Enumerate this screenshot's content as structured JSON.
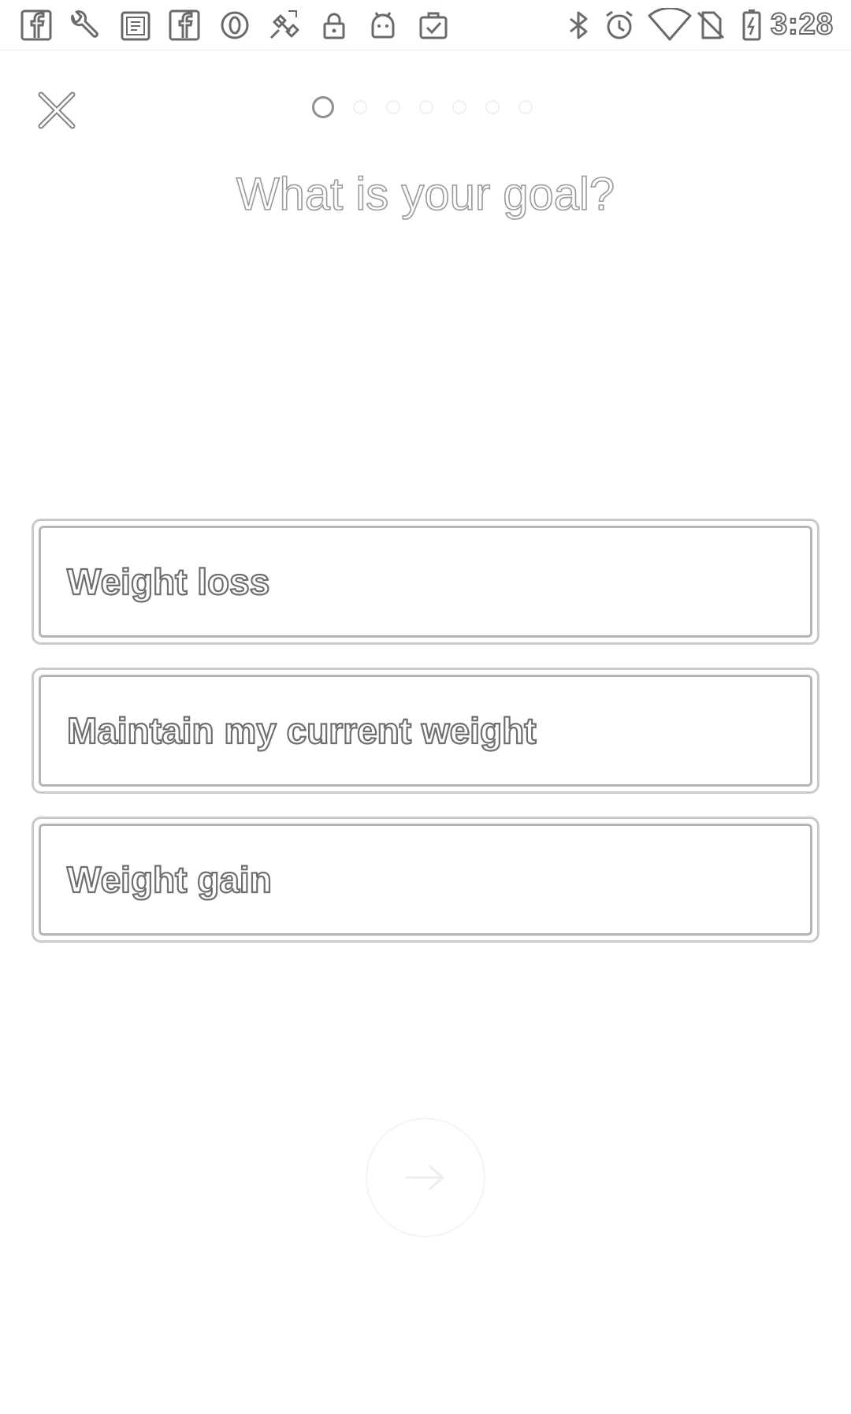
{
  "status_bar": {
    "time": "3:28",
    "left_icons": [
      "facebook-icon",
      "wrench-icon",
      "calendar-app-icon",
      "facebook-icon",
      "opera-icon",
      "satellite-icon",
      "lock-icon",
      "android-icon",
      "clipboard-check-icon"
    ],
    "right_icons": [
      "bluetooth-icon",
      "alarm-icon",
      "wifi-icon",
      "no-sim-icon",
      "battery-charging-icon"
    ]
  },
  "header": {
    "close_icon": "close-icon",
    "progress": {
      "current_step": 1,
      "total_steps": 7
    }
  },
  "title": "What is your goal?",
  "options": [
    {
      "label": "Weight loss"
    },
    {
      "label": "Maintain my current weight"
    },
    {
      "label": "Weight gain"
    }
  ],
  "next_button": {
    "icon": "arrow-right-icon",
    "enabled": false
  },
  "colors": {
    "background": "#ffffff",
    "outline": "#b5b5b5",
    "text_stroke": "#6e6e6e",
    "disabled": "#f0f0f0"
  }
}
